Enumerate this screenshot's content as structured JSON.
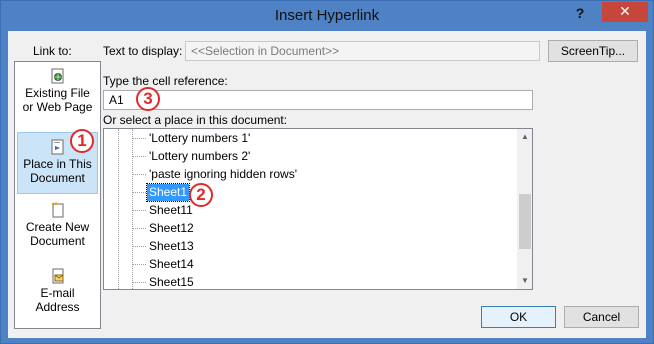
{
  "window": {
    "title": "Insert Hyperlink",
    "help_glyph": "?",
    "close_glyph": "✕",
    "colors": {
      "frame": "#4e82c4",
      "close": "#c7463b",
      "selection": "#3399ff",
      "annotation": "#e02a2a"
    }
  },
  "sidebar": {
    "heading": "Link to:",
    "items": [
      {
        "line1": "Existing File",
        "line2": "or Web Page",
        "icon": "globe-document-icon"
      },
      {
        "line1": "Place in This",
        "line2": "Document",
        "icon": "place-in-document-icon"
      },
      {
        "line1": "Create New",
        "line2": "Document",
        "icon": "new-document-icon"
      },
      {
        "line1": "E-mail",
        "line2": "Address",
        "icon": "email-icon"
      }
    ]
  },
  "display": {
    "label": "Text to display:",
    "value": "<<Selection in Document>>"
  },
  "screentip_label": "ScreenTip...",
  "cell_ref": {
    "label": "Type the cell reference:",
    "value": "A1"
  },
  "place": {
    "label": "Or select a place in this document:",
    "items": [
      "'Lottery numbers 1'",
      "'Lottery numbers 2'",
      "'paste ignoring hidden rows'",
      "Sheet1",
      "Sheet11",
      "Sheet12",
      "Sheet13",
      "Sheet14",
      "Sheet15"
    ],
    "selected": "Sheet1"
  },
  "buttons": {
    "ok": "OK",
    "cancel": "Cancel"
  },
  "markers": [
    "1",
    "2",
    "3"
  ]
}
